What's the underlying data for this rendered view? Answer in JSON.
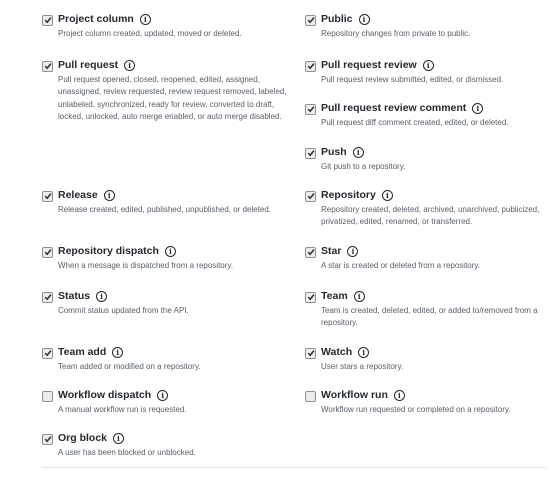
{
  "events": {
    "project_column": {
      "label": "Project column",
      "description": "Project column created, updated, moved or deleted.",
      "checked": true
    },
    "pull_request": {
      "label": "Pull request",
      "description": "Pull request opened, closed, reopened, edited, assigned, unassigned, review requested, review request removed, labeled, unlabeled, synchronized, ready for review, converted to draft, locked, unlocked, auto merge enabled, or auto merge disabled.",
      "checked": true
    },
    "release": {
      "label": "Release",
      "description": "Release created, edited, published, unpublished, or deleted.",
      "checked": true
    },
    "repository_dispatch": {
      "label": "Repository dispatch",
      "description": "When a message is dispatched from a repository.",
      "checked": true
    },
    "status": {
      "label": "Status",
      "description": "Commit status updated from the API.",
      "checked": true
    },
    "team_add": {
      "label": "Team add",
      "description": "Team added or modified on a repository.",
      "checked": true
    },
    "workflow_dispatch": {
      "label": "Workflow dispatch",
      "description": "A manual workflow run is requested.",
      "checked": false
    },
    "org_block": {
      "label": "Org block",
      "description": "A user has been blocked or unblocked.",
      "checked": true
    },
    "public": {
      "label": "Public",
      "description": "Repository changes from private to public.",
      "checked": true
    },
    "pull_request_review": {
      "label": "Pull request review",
      "description": "Pull request review submitted, edited, or dismissed.",
      "checked": true
    },
    "pull_request_review_comment": {
      "label": "Pull request review comment",
      "description": "Pull request diff comment created, edited, or deleted.",
      "checked": true
    },
    "push": {
      "label": "Push",
      "description": "Git push to a repository.",
      "checked": true
    },
    "repository": {
      "label": "Repository",
      "description": "Repository created, deleted, archived, unarchived, publicized, privatized, edited, renamed, or transferred.",
      "checked": true
    },
    "star": {
      "label": "Star",
      "description": "A star is created or deleted from a repository.",
      "checked": true
    },
    "team": {
      "label": "Team",
      "description": "Team is created, deleted, edited, or added to/removed from a repository.",
      "checked": true
    },
    "watch": {
      "label": "Watch",
      "description": "User stars a repository.",
      "checked": true
    },
    "workflow_run": {
      "label": "Workflow run",
      "description": "Workflow run requested or completed on a repository.",
      "checked": false
    }
  },
  "info_glyph": "i",
  "colors": {
    "title": "#24292e",
    "description": "#586069",
    "checkbox_border": "#8f8f8f",
    "checkbox_fill": "#ededed",
    "checkmark": "#333333"
  }
}
